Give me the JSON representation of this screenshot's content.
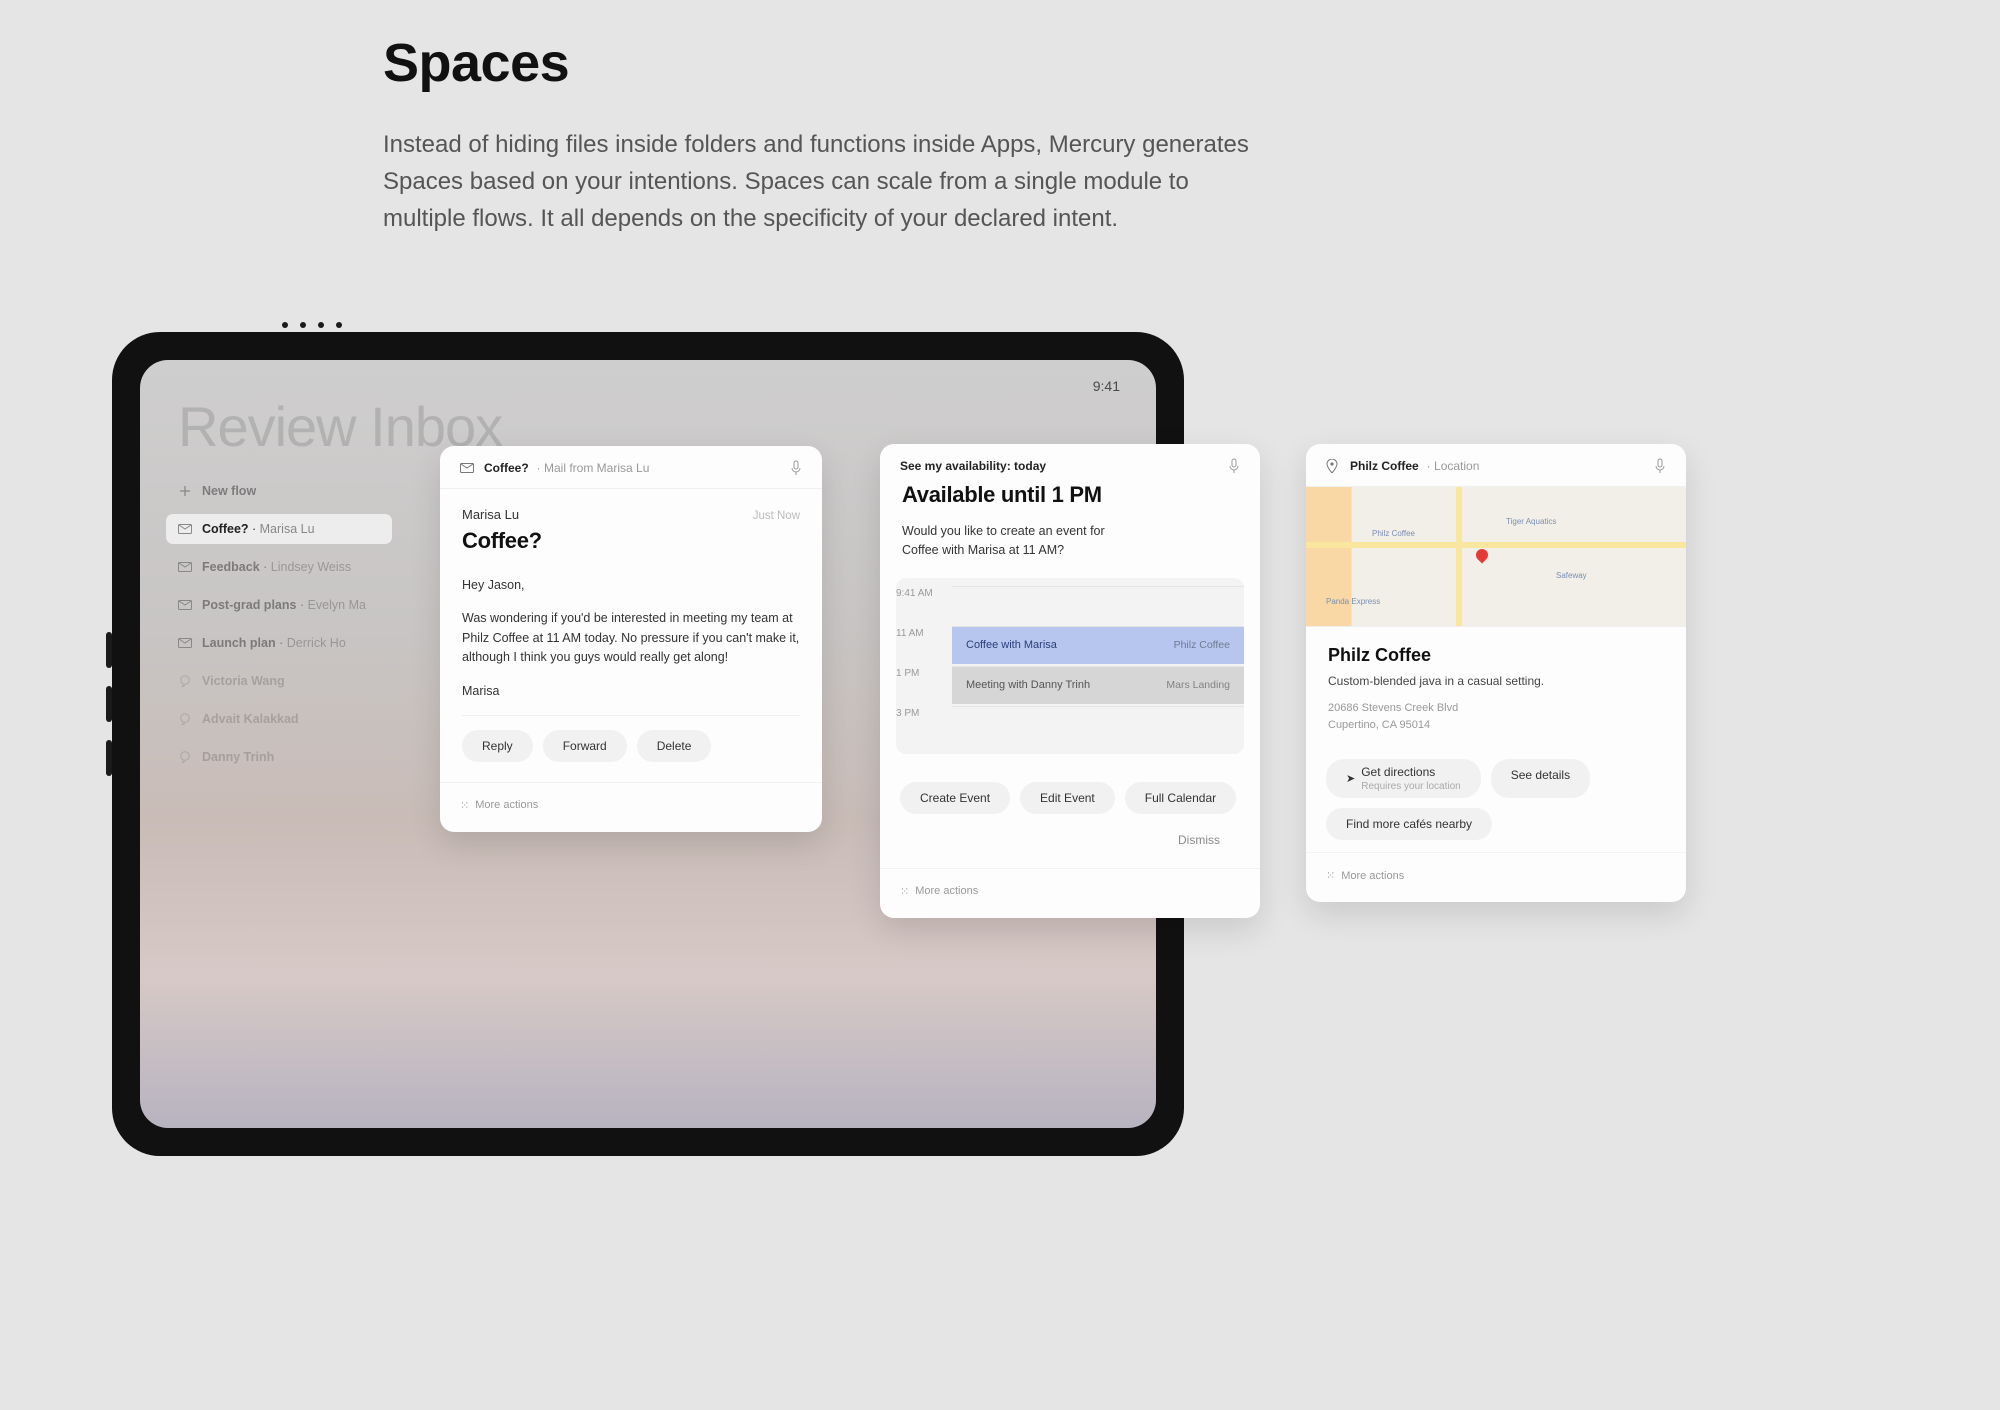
{
  "hero": {
    "title": "Spaces",
    "body": "Instead of hiding files inside folders and functions inside Apps, Mercury generates Spaces based on your intentions. Spaces can scale from a single module to multiple flows. It all depends on the specificity of your declared intent."
  },
  "status": {
    "time": "9:41"
  },
  "ghost_title": "Review Inbox",
  "sidebar": {
    "new_flow": "New flow",
    "items": [
      {
        "title": "Coffee?",
        "sub": "Marisa Lu",
        "kind": "mail",
        "active": true
      },
      {
        "title": "Feedback",
        "sub": "Lindsey Weiss",
        "kind": "mail"
      },
      {
        "title": "Post-grad plans",
        "sub": "Evelyn Ma",
        "kind": "mail"
      },
      {
        "title": "Launch plan",
        "sub": "Derrick Ho",
        "kind": "mail"
      },
      {
        "title": "Victoria Wang",
        "sub": "",
        "kind": "chat"
      },
      {
        "title": "Advait Kalakkad",
        "sub": "",
        "kind": "chat"
      },
      {
        "title": "Danny Trinh",
        "sub": "",
        "kind": "chat"
      }
    ]
  },
  "mail": {
    "context_title": "Coffee?",
    "context_sub": "Mail from Marisa Lu",
    "from": "Marisa Lu",
    "when": "Just Now",
    "subject": "Coffee?",
    "greeting": "Hey Jason,",
    "para": "Was wondering if you'd be interested in meeting my team at Philz Coffee at 11 AM today. No pressure if you can't make it, although I think you guys would really get along!",
    "signoff": "Marisa",
    "actions": {
      "reply": "Reply",
      "forward": "Forward",
      "delete": "Delete"
    },
    "more": "More actions"
  },
  "avail": {
    "context": "See my availability: today",
    "headline": "Available until 1 PM",
    "question": "Would you like to create an event for Coffee with Marisa at 11 AM?",
    "times": [
      "9:41 AM",
      "11 AM",
      "1 PM",
      "3 PM"
    ],
    "events": [
      {
        "title": "Coffee with Marisa",
        "loc": "Philz Coffee",
        "style": "blue"
      },
      {
        "title": "Meeting with Danny Trinh",
        "loc": "Mars Landing",
        "style": "grey"
      }
    ],
    "actions": {
      "create": "Create Event",
      "edit": "Edit Event",
      "full": "Full Calendar",
      "dismiss": "Dismiss"
    },
    "more": "More actions"
  },
  "loc": {
    "context_title": "Philz Coffee",
    "context_sub": "Location",
    "title": "Philz Coffee",
    "desc": "Custom-blended java in a casual setting.",
    "addr1": "20686 Stevens Creek Blvd",
    "addr2": "Cupertino, CA 95014",
    "actions": {
      "directions": "Get directions",
      "directions_sub": "Requires your location",
      "details": "See details",
      "nearby": "Find more cafés nearby"
    },
    "more": "More actions"
  }
}
